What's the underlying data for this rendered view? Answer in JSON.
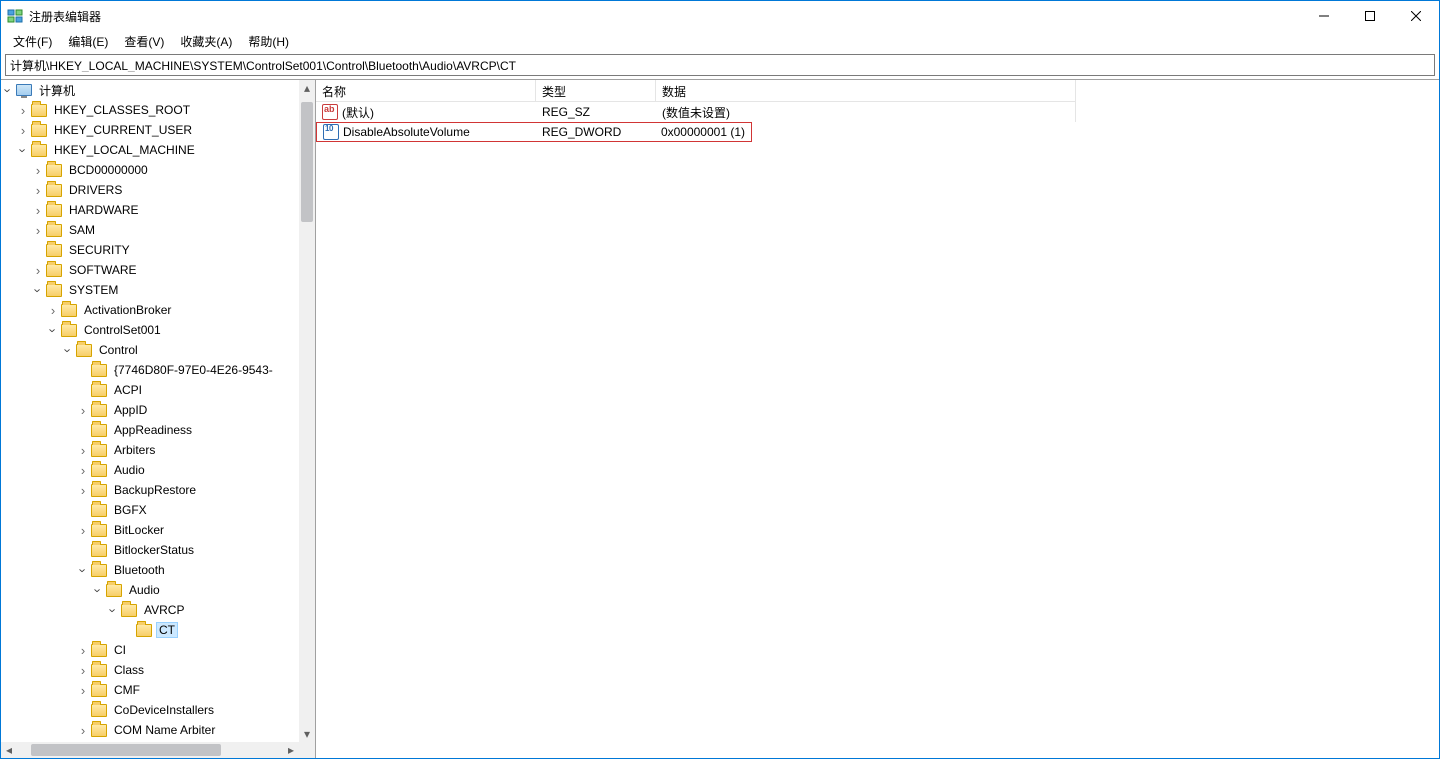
{
  "window": {
    "title": "注册表编辑器"
  },
  "menu": {
    "file": "文件(F)",
    "edit": "编辑(E)",
    "view": "查看(V)",
    "favorites": "收藏夹(A)",
    "help": "帮助(H)"
  },
  "address": "计算机\\HKEY_LOCAL_MACHINE\\SYSTEM\\ControlSet001\\Control\\Bluetooth\\Audio\\AVRCP\\CT",
  "tree": {
    "root": "计算机",
    "hkcr": "HKEY_CLASSES_ROOT",
    "hkcu": "HKEY_CURRENT_USER",
    "hklm": "HKEY_LOCAL_MACHINE",
    "bcd": "BCD00000000",
    "drivers": "DRIVERS",
    "hardware": "HARDWARE",
    "sam": "SAM",
    "security": "SECURITY",
    "software": "SOFTWARE",
    "system": "SYSTEM",
    "activationbroker": "ActivationBroker",
    "controlset001": "ControlSet001",
    "control": "Control",
    "guid": "{7746D80F-97E0-4E26-9543-",
    "acpi": "ACPI",
    "appid": "AppID",
    "appreadiness": "AppReadiness",
    "arbiters": "Arbiters",
    "audio": "Audio",
    "backuprestore": "BackupRestore",
    "bgfx": "BGFX",
    "bitlocker": "BitLocker",
    "bitlockerstatus": "BitlockerStatus",
    "bluetooth": "Bluetooth",
    "bt_audio": "Audio",
    "avrcp": "AVRCP",
    "ct": "CT",
    "ci": "CI",
    "class": "Class",
    "cmf": "CMF",
    "codeviceinstallers": "CoDeviceInstallers",
    "comnamearbiter": "COM Name Arbiter"
  },
  "columns": {
    "name": "名称",
    "type": "类型",
    "data": "数据"
  },
  "values": [
    {
      "icon": "str",
      "name": "(默认)",
      "type": "REG_SZ",
      "data": "(数值未设置)"
    },
    {
      "icon": "bin",
      "name": "DisableAbsoluteVolume",
      "type": "REG_DWORD",
      "data": "0x00000001 (1)"
    }
  ]
}
